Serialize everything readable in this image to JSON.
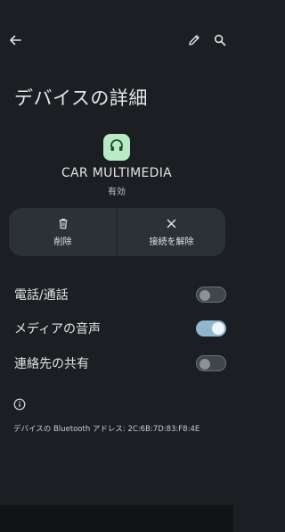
{
  "page": {
    "title": "デバイスの詳細"
  },
  "topbar": {
    "back_icon": "arrow-back-icon",
    "edit_icon": "pencil-icon",
    "search_icon": "search-icon"
  },
  "device": {
    "icon": "headset-icon",
    "name": "CAR MULTIMEDIA",
    "status": "有効",
    "icon_bg": "#b9eac3"
  },
  "actions": {
    "delete_label": "削除",
    "disconnect_label": "接続を解除"
  },
  "settings": [
    {
      "label": "電話/通話",
      "enabled": false
    },
    {
      "label": "メディアの音声",
      "enabled": true
    },
    {
      "label": "連絡先の共有",
      "enabled": false
    }
  ],
  "info": {
    "icon": "info-icon",
    "address_text": "デバイスの Bluetooth アドレス: 2C:6B:7D:83:F8:4E"
  },
  "colors": {
    "background": "#1b1f23",
    "toggle_on": "#8fb8cd"
  }
}
